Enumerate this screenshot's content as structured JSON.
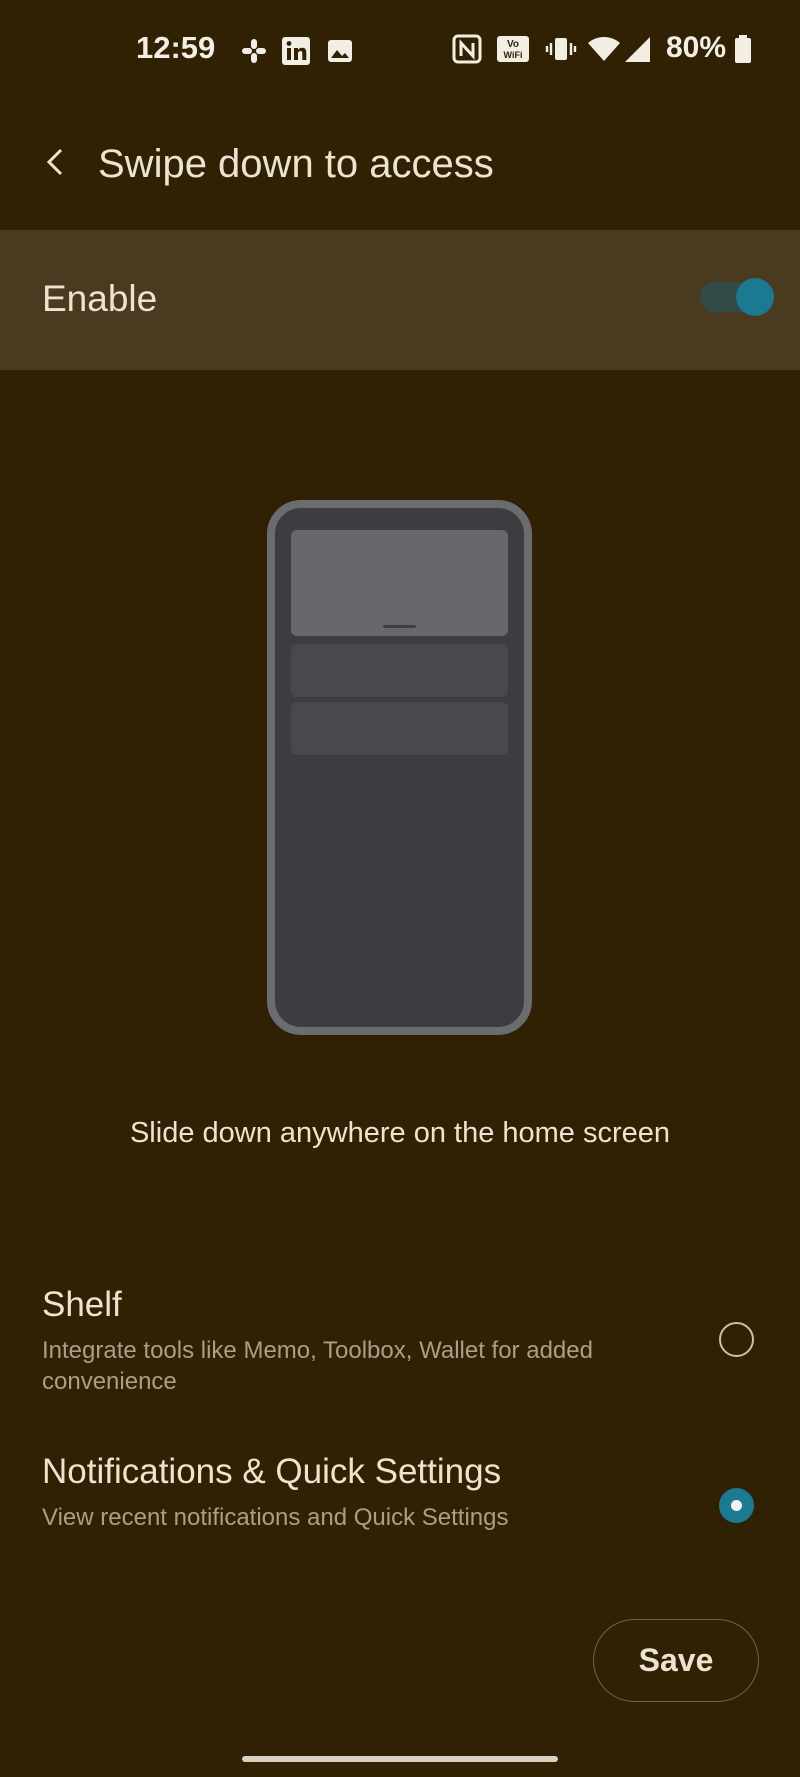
{
  "status_bar": {
    "time": "12:59",
    "notification_icons": [
      "slack-icon",
      "linkedin-icon",
      "gallery-icon"
    ],
    "system_icons": [
      "nfc-icon",
      "vowifi-icon",
      "vibrate-icon",
      "wifi-icon",
      "signal-icon",
      "battery-icon"
    ],
    "battery_percent": "80%"
  },
  "header": {
    "title": "Swipe down to access"
  },
  "enable": {
    "label": "Enable",
    "toggle_on": true
  },
  "illustration": {
    "caption": "Slide down anywhere on the home screen"
  },
  "options": [
    {
      "title": "Shelf",
      "subtitle": "Integrate tools like Memo, Toolbox, Wallet for added convenience",
      "selected": false
    },
    {
      "title": "Notifications & Quick Settings",
      "subtitle": "View recent notifications and Quick Settings",
      "selected": true
    }
  ],
  "save_label": "Save",
  "colors": {
    "background": "#302105",
    "enable_row": "#493a20",
    "accent": "#1b7a92"
  }
}
